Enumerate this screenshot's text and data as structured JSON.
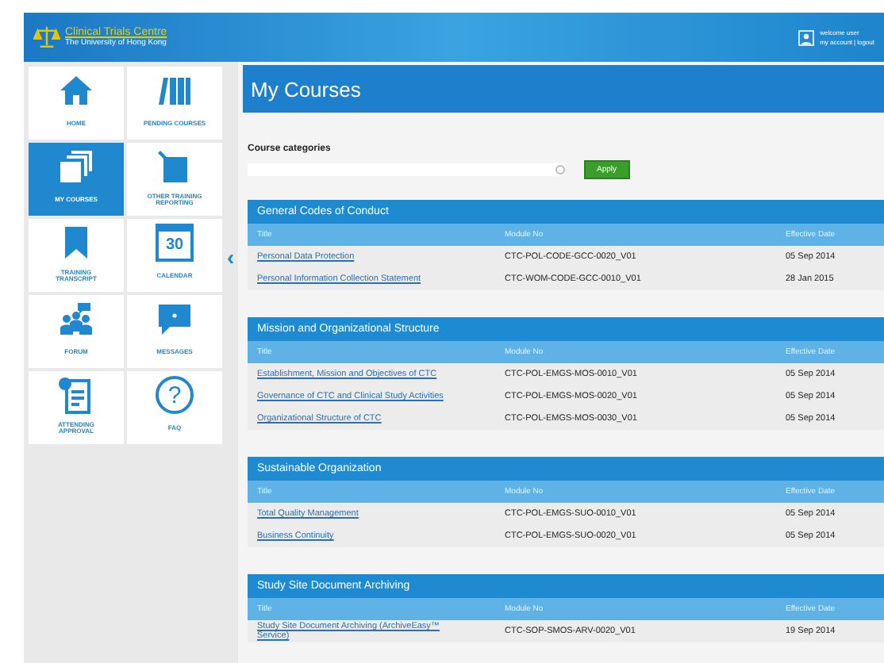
{
  "header": {
    "logo_title": "Clinical Trials Centre",
    "logo_subtitle": "The University of Hong Kong",
    "welcome": "welcome user",
    "account_links": [
      {
        "label": "my account"
      },
      {
        "label": "logout"
      }
    ],
    "separator": "|"
  },
  "sidebar": {
    "rows": [
      {
        "tiles": [
          {
            "kind": "home",
            "label": "HOME",
            "selected": false
          },
          {
            "kind": "books",
            "label": "PENDING COURSES",
            "selected": false
          }
        ]
      },
      {
        "tiles": [
          {
            "kind": "pages",
            "label": "MY COURSES",
            "selected": true
          },
          {
            "kind": "report",
            "label": "OTHER TRAINING REPORTING",
            "selected": false
          }
        ]
      },
      {
        "tiles": [
          {
            "kind": "bookmark",
            "label": "TRAINING TRANSCRIPT",
            "selected": false
          },
          {
            "kind": "calendar",
            "label": "CALENDAR",
            "selected": false,
            "icon_text": "30"
          }
        ]
      },
      {
        "tiles": [
          {
            "kind": "forum",
            "label": "FORUM",
            "selected": false
          },
          {
            "kind": "message",
            "label": "MESSAGES",
            "selected": false
          }
        ]
      },
      {
        "tiles": [
          {
            "kind": "approval",
            "label": "ATTENDING APPROVAL",
            "selected": false
          },
          {
            "kind": "faq",
            "label": "FAQ",
            "selected": false,
            "icon_text": "?"
          }
        ]
      }
    ],
    "collapse": "‹"
  },
  "main": {
    "title": "My Courses",
    "filter_label": "Course categories",
    "apply_button": "Apply",
    "groups": [
      {
        "name": "General Codes of Conduct",
        "columns": [
          "Title",
          "Module No",
          "Effective Date"
        ],
        "rows": [
          {
            "title": "Personal Data Protection",
            "module": "CTC-POL-CODE-GCC-0020_V01",
            "date": "05 Sep 2014"
          },
          {
            "title": "Personal Information Collection Statement",
            "module": "CTC-WOM-CODE-GCC-0010_V01",
            "date": "28 Jan 2015"
          }
        ]
      },
      {
        "name": "Mission and Organizational Structure",
        "columns": [
          "Title",
          "Module No",
          "Effective Date"
        ],
        "rows": [
          {
            "title": "Establishment, Mission and Objectives of CTC",
            "module": "CTC-POL-EMGS-MOS-0010_V01",
            "date": "05 Sep 2014"
          },
          {
            "title": "Governance of CTC and Clinical Study Activities",
            "module": "CTC-POL-EMGS-MOS-0020_V01",
            "date": "05 Sep 2014"
          },
          {
            "title": "Organizational Structure of CTC",
            "module": "CTC-POL-EMGS-MOS-0030_V01",
            "date": "05 Sep 2014"
          }
        ]
      },
      {
        "name": "Sustainable Organization",
        "columns": [
          "Title",
          "Module No",
          "Effective Date"
        ],
        "rows": [
          {
            "title": "Total Quality Management",
            "module": "CTC-POL-EMGS-SUO-0010_V01",
            "date": "05 Sep 2014"
          },
          {
            "title": "Business Continuity",
            "module": "CTC-POL-EMGS-SUO-0020_V01",
            "date": "05 Sep 2014"
          }
        ]
      },
      {
        "name": "Study Site Document Archiving",
        "columns": [
          "Title",
          "Module No",
          "Effective Date"
        ],
        "rows": [
          {
            "title": "Study Site Document Archiving (ArchiveEasy™ Service)",
            "module": "CTC-SOP-SMOS-ARV-0020_V01",
            "date": "19 Sep 2014"
          }
        ]
      }
    ]
  }
}
